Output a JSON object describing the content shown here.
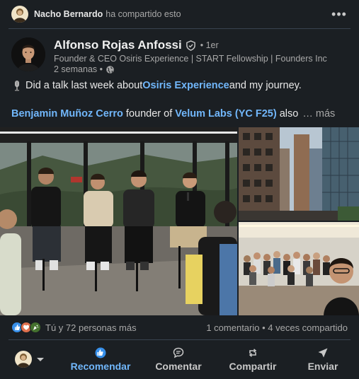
{
  "share_header": {
    "name": "Nacho Bernardo",
    "action": "ha compartido esto",
    "more_icon": "more-horizontal-icon"
  },
  "author": {
    "name": "Alfonso Rojas Anfossi",
    "degree": "• 1er",
    "headline": "Founder & CEO Osiris Experience | START Fellowship | Founders Inc",
    "time": "2 semanas •",
    "verified_icon": "verified-shield-icon",
    "visibility_icon": "globe-icon"
  },
  "post": {
    "line1_pre": "Did a talk last week about ",
    "line1_link": "Osiris Experience",
    "line1_post": " and my journey.",
    "line2_mention1": "Benjamin Muñoz Cerro",
    "line2_mid": " founder of ",
    "line2_mention2": "Velum Labs (YC F25)",
    "line2_post": " also",
    "see_more": "… más"
  },
  "images": [
    "panel-talk-photo",
    "city-skyscrapers-photo",
    "group-selfie-photo"
  ],
  "social": {
    "reaction_icons": [
      "like-icon",
      "love-icon",
      "celebrate-icon"
    ],
    "reactions_text": "Tú y 72 personas más",
    "comments": "1 comentario",
    "separator": " • ",
    "shares": "4 veces compartido"
  },
  "actions": {
    "recommend": "Recomendar",
    "comment": "Comentar",
    "share": "Compartir",
    "send": "Enviar"
  },
  "colors": {
    "background": "#1b1f23",
    "link": "#71b7fb",
    "muted": "#a8a8a8",
    "divider": "#38434f"
  }
}
